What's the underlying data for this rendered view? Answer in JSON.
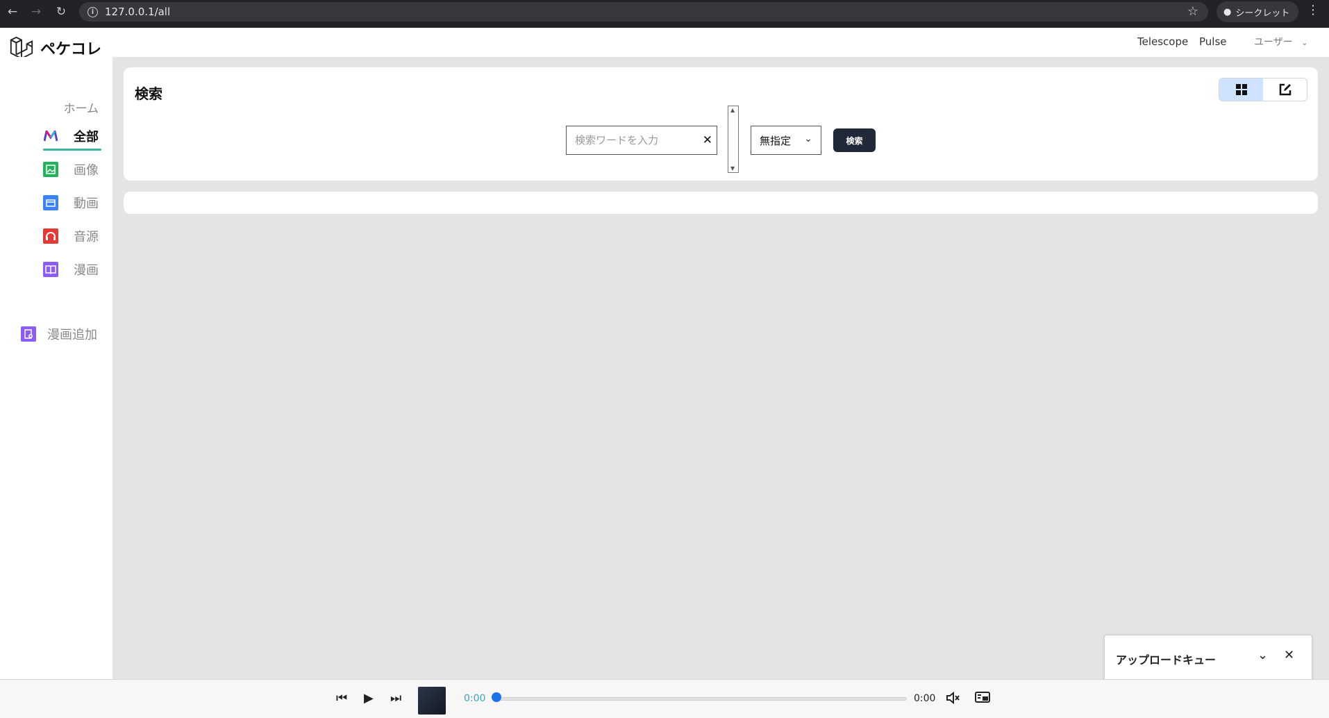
{
  "browser": {
    "url": "127.0.0.1/all",
    "incognito_label": "シークレット"
  },
  "header": {
    "brand": "ペケコレ",
    "links": [
      "Telescope",
      "Pulse"
    ],
    "user_menu": "ユーザー"
  },
  "sidebar": {
    "home": "ホーム",
    "items": [
      {
        "label": "全部",
        "icon": "all-icon",
        "color": "#5b3fd1",
        "active": true
      },
      {
        "label": "画像",
        "icon": "image-icon",
        "color": "#22b35a"
      },
      {
        "label": "動画",
        "icon": "video-icon",
        "color": "#3b82f6"
      },
      {
        "label": "音源",
        "icon": "headphones-icon",
        "color": "#e53935"
      },
      {
        "label": "漫画",
        "icon": "book-icon",
        "color": "#8b5cf6"
      }
    ],
    "add_manga": "漫画追加",
    "add_color": "#8b5cf6"
  },
  "search": {
    "title": "検索",
    "placeholder": "検索ワードを入力",
    "select_value": "無指定",
    "button": "検索"
  },
  "upload_queue": {
    "title": "アップロードキュー"
  },
  "player": {
    "current_time": "0:00",
    "total_time": "0:00",
    "progress": 0
  }
}
